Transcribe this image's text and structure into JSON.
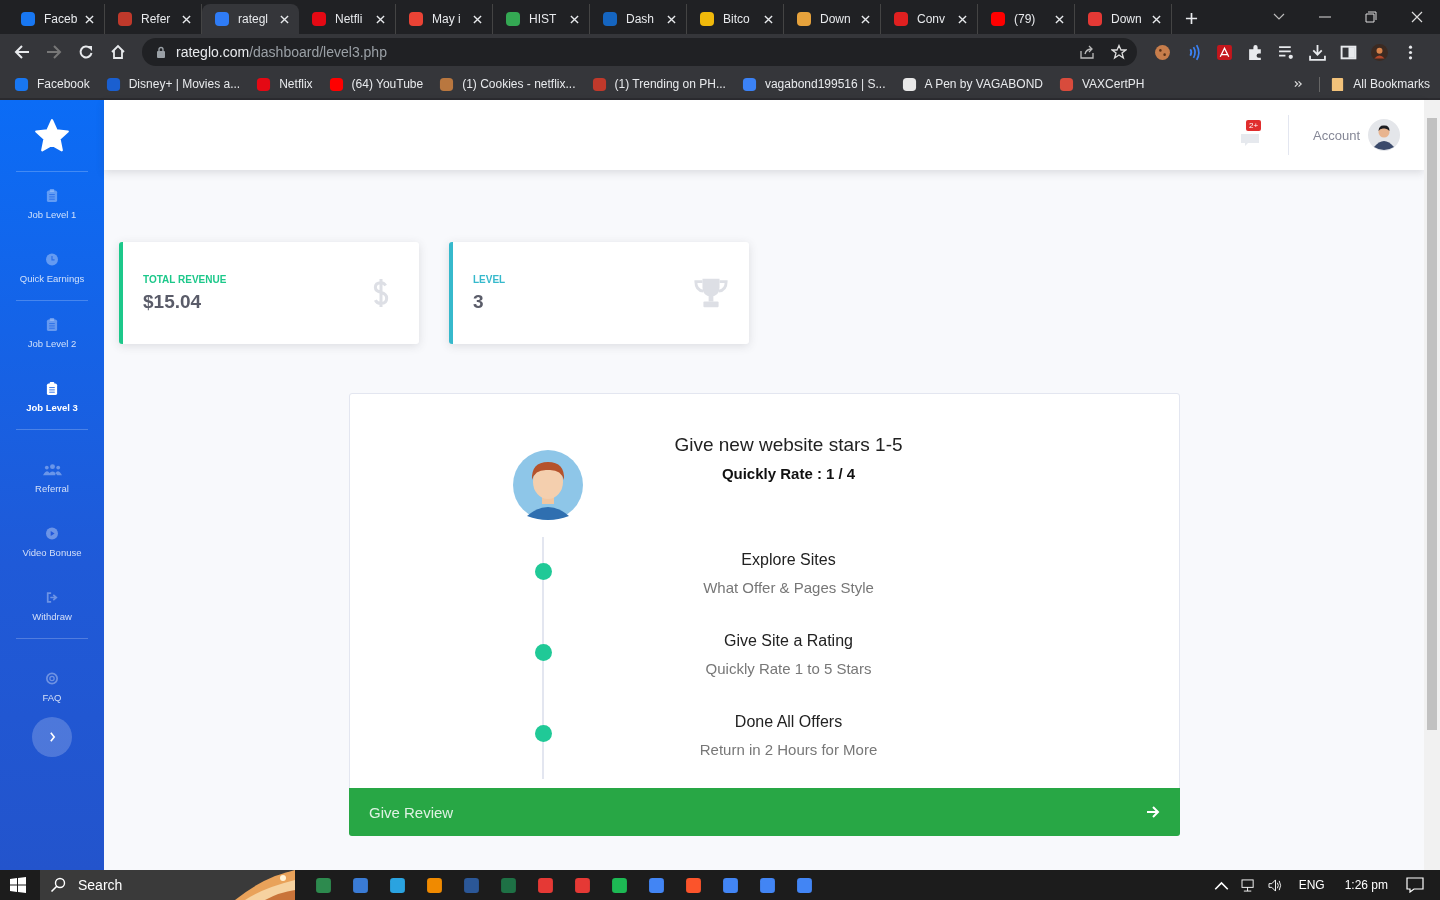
{
  "browser": {
    "tabs": [
      {
        "title": "Faceb",
        "color": "#1877f2",
        "selected": false
      },
      {
        "title": "Refer",
        "color": "#c0392b",
        "selected": false
      },
      {
        "title": "rategl",
        "color": "#2f7cf6",
        "selected": true
      },
      {
        "title": "Netfli",
        "color": "#e50914",
        "selected": false
      },
      {
        "title": "May i",
        "color": "#ea4335",
        "selected": false
      },
      {
        "title": "HIST",
        "color": "#34a853",
        "selected": false
      },
      {
        "title": "Dash",
        "color": "#1565c0",
        "selected": false
      },
      {
        "title": "Bitco",
        "color": "#f0b90b",
        "selected": false
      },
      {
        "title": "Down",
        "color": "#e6a23c",
        "selected": false
      },
      {
        "title": "Conv",
        "color": "#e02020",
        "selected": false
      },
      {
        "title": "(79)",
        "color": "#ff0000",
        "selected": false
      },
      {
        "title": "Down",
        "color": "#e53935",
        "selected": false
      }
    ],
    "address": {
      "host": "rateglo.com",
      "path": "/dashboard/level3.php"
    },
    "bookmarks": [
      {
        "label": "Facebook",
        "color": "#1877f2"
      },
      {
        "label": "Disney+ | Movies a...",
        "color": "#1a5fd0"
      },
      {
        "label": "Netflix",
        "color": "#e50914"
      },
      {
        "label": "(64) YouTube",
        "color": "#ff0000"
      },
      {
        "label": "(1) Cookies - netflix...",
        "color": "#b9773f"
      },
      {
        "label": "(1) Trending on PH...",
        "color": "#c0392b"
      },
      {
        "label": "vagabond199516 | S...",
        "color": "#3b82f6"
      },
      {
        "label": "A Pen by VAGABOND",
        "color": "#e8e8e8"
      },
      {
        "label": "VAXCertPH",
        "color": "#d84b3c"
      }
    ],
    "all_bookmarks": "All Bookmarks"
  },
  "sidebar": {
    "groups": [
      {
        "items": [
          {
            "label": "Job Level 1",
            "kind": "clipboard",
            "selected": false
          },
          {
            "label": "Quick Earnings",
            "kind": "clock",
            "selected": false
          }
        ]
      },
      {
        "items": [
          {
            "label": "Job Level 2",
            "kind": "clipboard",
            "selected": false
          },
          {
            "label": "Job Level 3",
            "kind": "clipboard",
            "selected": true
          }
        ]
      },
      {
        "items": [
          {
            "label": "Referral",
            "kind": "users",
            "selected": false
          },
          {
            "label": "Video Bonuse",
            "kind": "play",
            "selected": false
          },
          {
            "label": "Withdraw",
            "kind": "exit",
            "selected": false
          }
        ]
      },
      {
        "items": [
          {
            "label": "FAQ",
            "kind": "help",
            "selected": false
          }
        ]
      }
    ]
  },
  "header": {
    "notification_count": "2+",
    "account": "Account"
  },
  "stats": [
    {
      "label": "TOTAL REVENUE",
      "value": "$15.04",
      "kind": "dollar",
      "color": "#1cc88a"
    },
    {
      "label": "LEVEL",
      "value": "3",
      "kind": "trophy",
      "color": "#36b9cc"
    }
  ],
  "task": {
    "title": "Give new website stars 1-5",
    "rate_label": "Quickly Rate :",
    "rate_count": "1 / 4",
    "steps": [
      {
        "title": "Explore Sites",
        "subtitle": "What Offer & Pages Style"
      },
      {
        "title": "Give Site a Rating",
        "subtitle": "Quickly Rate 1 to 5 Stars"
      },
      {
        "title": "Done All Offers",
        "subtitle": "Return in 2 Hours for More"
      }
    ],
    "button": "Give Review"
  },
  "taskbar": {
    "search": "Search",
    "language": "ENG",
    "time": "1:26 pm"
  }
}
